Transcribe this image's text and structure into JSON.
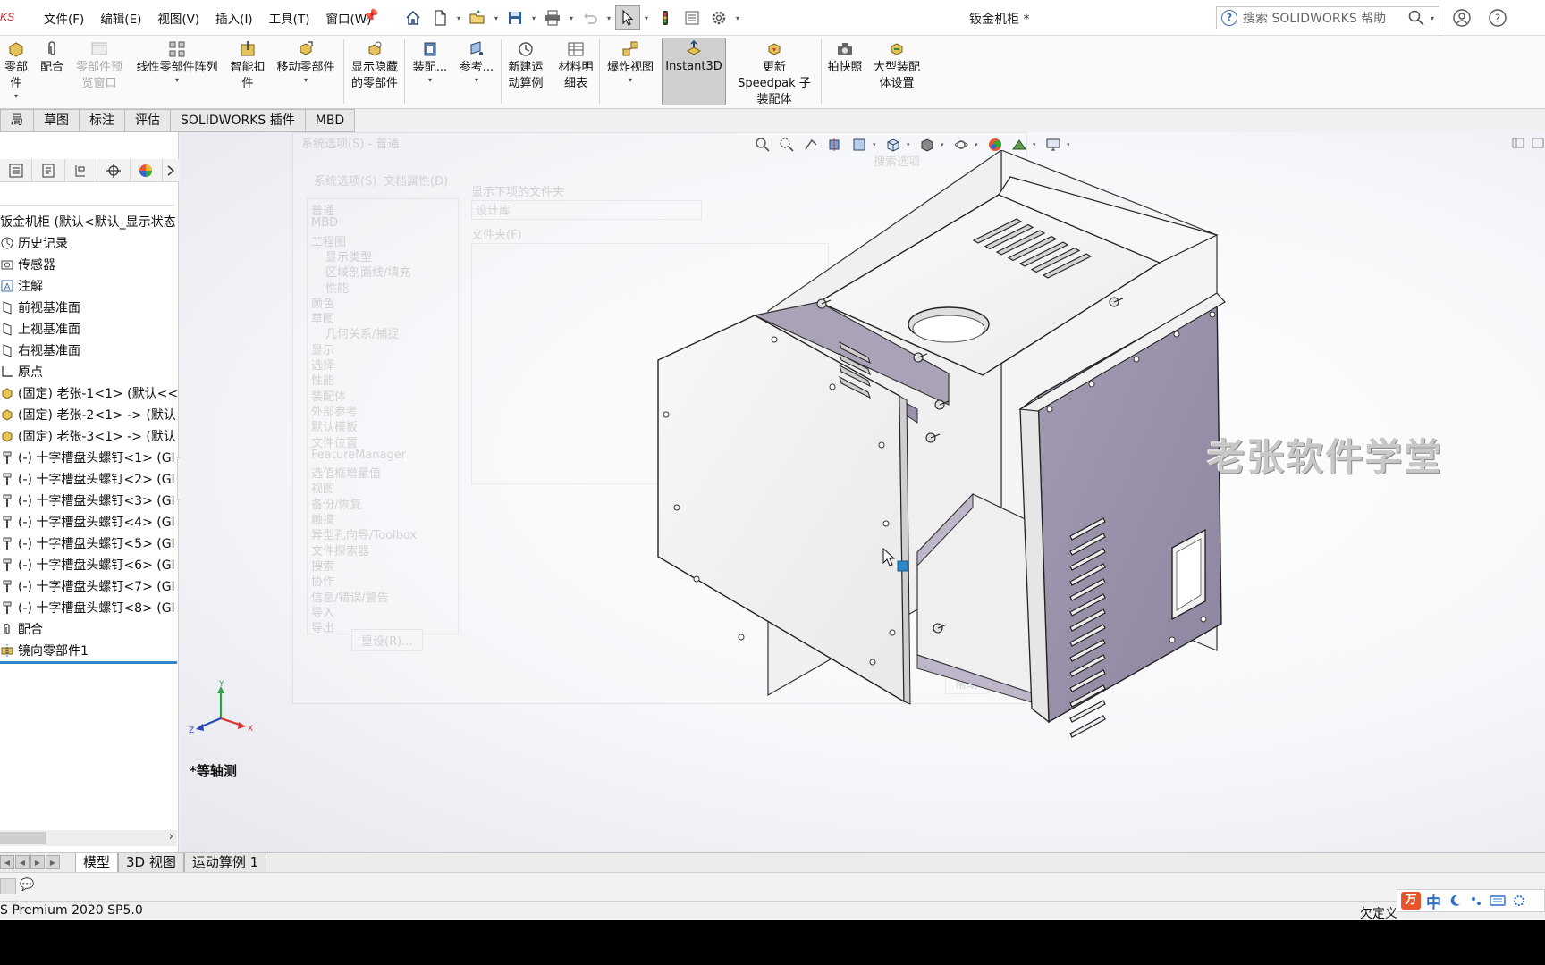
{
  "titlebar": {
    "brand": "KS",
    "menus": [
      "文件(F)",
      "编辑(E)",
      "视图(V)",
      "插入(I)",
      "工具(T)",
      "窗口(W)"
    ],
    "doc_title": "钣金机柜 *",
    "search_placeholder": "搜索 SOLIDWORKS 帮助"
  },
  "command_manager": {
    "buttons": [
      {
        "label": "零部件",
        "caret": true,
        "enabled": true
      },
      {
        "label": "配合",
        "caret": false,
        "enabled": true
      },
      {
        "label": "零部件预览窗口",
        "caret": false,
        "enabled": false
      },
      {
        "label": "线性零部件阵列",
        "caret": true,
        "enabled": true
      },
      {
        "label": "智能扣件",
        "caret": false,
        "enabled": true
      },
      {
        "label": "移动零部件",
        "caret": true,
        "enabled": true
      },
      {
        "label": "显示隐藏的零部件",
        "caret": false,
        "enabled": true
      },
      {
        "label": "装配...",
        "caret": true,
        "enabled": true
      },
      {
        "label": "参考...",
        "caret": true,
        "enabled": true
      },
      {
        "label": "新建运动算例",
        "caret": false,
        "enabled": true
      },
      {
        "label": "材料明细表",
        "caret": false,
        "enabled": true
      },
      {
        "label": "爆炸视图",
        "caret": true,
        "enabled": true
      },
      {
        "label": "Instant3D",
        "caret": false,
        "enabled": true,
        "pressed": true
      },
      {
        "label": "更新 Speedpak 子装配体",
        "caret": false,
        "enabled": true
      },
      {
        "label": "拍快照",
        "caret": false,
        "enabled": true
      },
      {
        "label": "大型装配体设置",
        "caret": false,
        "enabled": true
      }
    ]
  },
  "tabs": [
    "局",
    "草图",
    "标注",
    "评估",
    "SOLIDWORKS 插件",
    "MBD"
  ],
  "feature_tree": {
    "root": "钣金机柜 (默认<默认_显示状态",
    "items": [
      {
        "icon": "history-icon",
        "label": "历史记录"
      },
      {
        "icon": "sensor-icon",
        "label": "传感器"
      },
      {
        "icon": "annotation-icon",
        "label": "注解"
      },
      {
        "icon": "plane-icon",
        "label": "前视基准面"
      },
      {
        "icon": "plane-icon",
        "label": "上视基准面"
      },
      {
        "icon": "plane-icon",
        "label": "右视基准面"
      },
      {
        "icon": "origin-icon",
        "label": "原点"
      },
      {
        "icon": "part-icon",
        "label": "(固定) 老张-1<1> (默认<<"
      },
      {
        "icon": "part-icon",
        "label": "(固定) 老张-2<1> -> (默认"
      },
      {
        "icon": "part-icon",
        "label": "(固定) 老张-3<1> -> (默认"
      },
      {
        "icon": "screw-icon",
        "label": "(-) 十字槽盘头螺钉<1> (GI"
      },
      {
        "icon": "screw-icon",
        "label": "(-) 十字槽盘头螺钉<2> (GI"
      },
      {
        "icon": "screw-icon",
        "label": "(-) 十字槽盘头螺钉<3> (GI"
      },
      {
        "icon": "screw-icon",
        "label": "(-) 十字槽盘头螺钉<4> (GI"
      },
      {
        "icon": "screw-icon",
        "label": "(-) 十字槽盘头螺钉<5> (GI"
      },
      {
        "icon": "screw-icon",
        "label": "(-) 十字槽盘头螺钉<6> (GI"
      },
      {
        "icon": "screw-icon",
        "label": "(-) 十字槽盘头螺钉<7> (GI"
      },
      {
        "icon": "screw-icon",
        "label": "(-) 十字槽盘头螺钉<8> (GI"
      },
      {
        "icon": "mates-icon",
        "label": "配合"
      },
      {
        "icon": "mirror-icon",
        "label": "镜向零部件1"
      }
    ]
  },
  "ghost_dialog": {
    "title": "系统选项(S) - 普通",
    "tabs": [
      "系统选项(S)",
      "文档属性(D)"
    ],
    "search": "搜索选项",
    "list": [
      "普通",
      "MBD",
      "工程图",
      "显示类型",
      "区域剖面线/填充",
      "性能",
      "颜色",
      "草图",
      "几何关系/捕捉",
      "显示",
      "选择",
      "性能",
      "装配体",
      "外部参考",
      "默认模板",
      "文件位置",
      "FeatureManager",
      "选值框增量值",
      "视图",
      "备份/恢复",
      "触摸",
      "异型孔向导/Toolbox",
      "文件探索器",
      "搜索",
      "协作",
      "信息/错误/警告",
      "导入",
      "导出"
    ],
    "show_folders_label": "显示下项的文件夹",
    "show_folders_value": "设计库",
    "folders_label": "文件夹(F)",
    "reset_button": "重设(R)...",
    "help_button": "帮助"
  },
  "watermark": "老张软件学堂",
  "view_label": "*等轴测",
  "triad_axes": {
    "x": "X",
    "y": "Y",
    "z": "Z"
  },
  "bottom_tabs": [
    "模型",
    "3D 视图",
    "运动算例 1"
  ],
  "status": {
    "left": "S Premium 2020 SP5.0",
    "right": "欠定义"
  },
  "ime": {
    "logo": "万",
    "mode": "中"
  },
  "colors": {
    "accent": "#2f86c8",
    "panel_face": "#9c94ab",
    "sheet_metal": "#f1f1f1",
    "brand_red": "#d8232a"
  }
}
